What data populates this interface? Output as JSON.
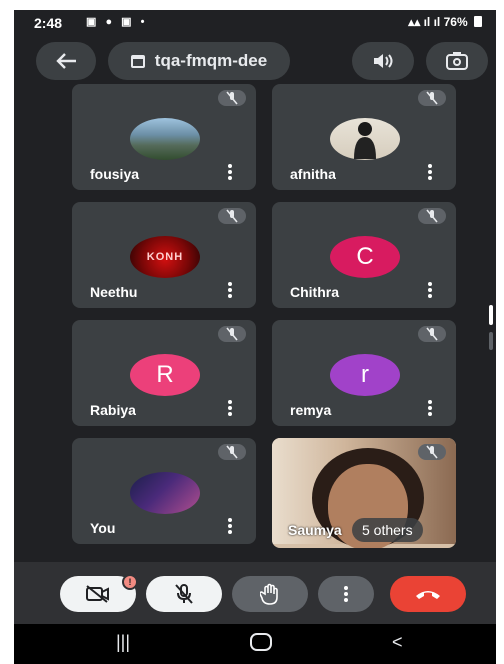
{
  "status": {
    "time": "2:48",
    "battery": "76%"
  },
  "header": {
    "meeting_code": "tqa-fmqm-dee"
  },
  "participants": [
    {
      "name": "fousiya"
    },
    {
      "name": "afnitha"
    },
    {
      "name": "Neethu",
      "avatar_text": "KONH"
    },
    {
      "name": "Chithra",
      "initial": "C"
    },
    {
      "name": "Rabiya",
      "initial": "R"
    },
    {
      "name": "remya",
      "initial": "r"
    },
    {
      "name": "You"
    },
    {
      "name": "Saumya",
      "others_label": "5 others"
    }
  ],
  "controls": {
    "camera_badge": "!"
  },
  "colors": {
    "end_call": "#ea4335",
    "tile_bg": "#3c4043",
    "background": "#202124"
  },
  "icons": [
    "back-arrow-icon",
    "calendar-icon",
    "speaker-icon",
    "camera-flip-icon",
    "mic-off-icon",
    "more-vert-icon",
    "camera-off-icon",
    "hand-icon",
    "end-call-icon"
  ]
}
